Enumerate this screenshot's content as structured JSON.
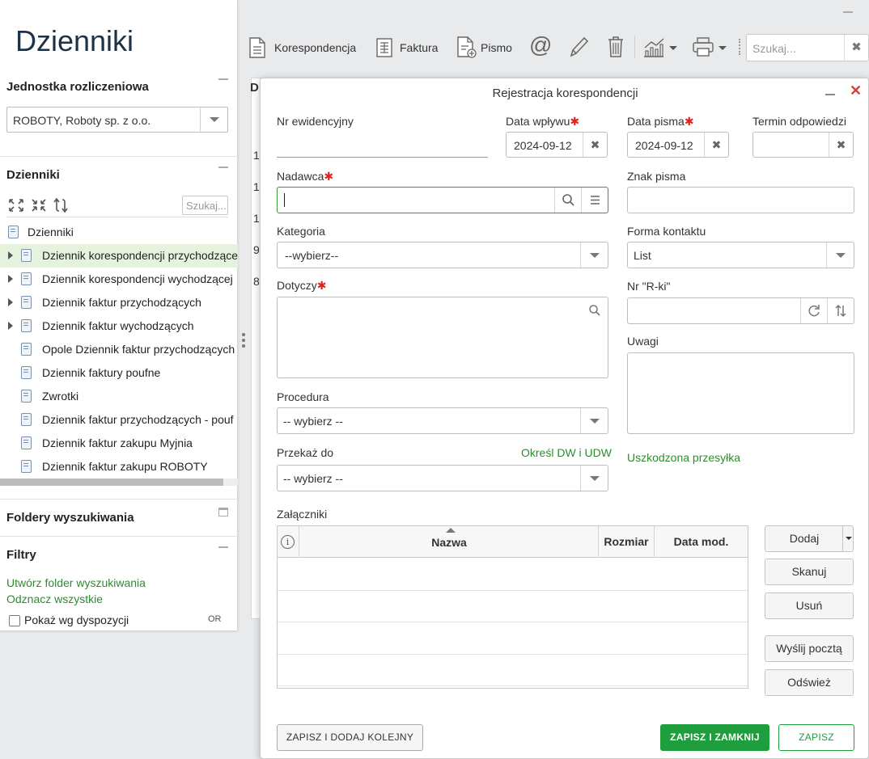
{
  "left": {
    "title": "Dzienniki",
    "unit_section": "Jednostka rozliczeniowa",
    "unit_value": "ROBOTY, Roboty sp. z o.o.",
    "journals_section": "Dzienniki",
    "search_placeholder": "Szukaj...",
    "tree_root": "Dzienniki",
    "tree_items": [
      {
        "label": "Dziennik korespondencji przychodzące",
        "expandable": true,
        "selected": true
      },
      {
        "label": "Dziennik korespondencji wychodzącej",
        "expandable": true,
        "selected": false
      },
      {
        "label": "Dziennik faktur przychodzących",
        "expandable": true,
        "selected": false
      },
      {
        "label": "Dziennik faktur wychodzących",
        "expandable": true,
        "selected": false
      },
      {
        "label": "Opole Dziennik faktur przychodzących",
        "expandable": false,
        "selected": false
      },
      {
        "label": "Dziennik faktury poufne",
        "expandable": false,
        "selected": false
      },
      {
        "label": "Zwrotki",
        "expandable": false,
        "selected": false
      },
      {
        "label": "Dziennik faktur przychodzących - pouf",
        "expandable": false,
        "selected": false
      },
      {
        "label": "Dziennik faktur zakupu Myjnia",
        "expandable": false,
        "selected": false
      },
      {
        "label": "Dziennik faktur zakupu ROBOTY",
        "expandable": false,
        "selected": false
      }
    ],
    "folders_section": "Foldery wyszukiwania",
    "filters_section": "Filtry",
    "create_folder_link": "Utwórz folder wyszukiwania",
    "uncheck_all_link": "Odznacz wszystkie",
    "show_by_disposition": "Pokaż wg dyspozycji",
    "or_label": "OR"
  },
  "toolbar": {
    "correspondence": "Korespondencja",
    "invoice": "Faktura",
    "letter": "Pismo",
    "search_placeholder": "Szukaj..."
  },
  "background": {
    "partial_header": "D",
    "row_numbers": [
      "1",
      "1",
      "1",
      "9",
      "8"
    ]
  },
  "dialog": {
    "title": "Rejestracja korespondencji",
    "evidence_no_label": "Nr ewidencyjny",
    "receipt_date_label": "Data wpływu",
    "receipt_date_value": "2024-09-12",
    "letter_date_label": "Data pisma",
    "letter_date_value": "2024-09-12",
    "response_deadline_label": "Termin odpowiedzi",
    "sender_label": "Nadawca",
    "letter_mark_label": "Znak pisma",
    "category_label": "Kategoria",
    "category_value": "--wybierz--",
    "contact_form_label": "Forma kontaktu",
    "contact_form_value": "List",
    "concerns_label": "Dotyczy",
    "rki_label": "Nr \"R-ki\"",
    "notes_label": "Uwagi",
    "procedure_label": "Procedura",
    "procedure_value": "-- wybierz --",
    "forward_to_label": "Przekaż do",
    "forward_to_value": "-- wybierz --",
    "specify_dw_link": "Określ DW i UDW",
    "damaged_link": "Uszkodzona przesyłka",
    "attachments_label": "Załączniki",
    "att_columns": {
      "name": "Nazwa",
      "size": "Rozmiar",
      "date": "Data mod."
    },
    "buttons": {
      "add": "Dodaj",
      "scan": "Skanuj",
      "remove": "Usuń",
      "send_mail": "Wyślij pocztą",
      "refresh": "Odśwież",
      "save_add_next": "ZAPISZ I DODAJ KOLEJNY",
      "save_close": "ZAPISZ I ZAMKNIJ",
      "save": "ZAPISZ"
    }
  },
  "colors": {
    "accent_green": "#1e9e3c",
    "link_green": "#2e8b2e",
    "required_red": "#e0231b",
    "close_red": "#e53935"
  }
}
